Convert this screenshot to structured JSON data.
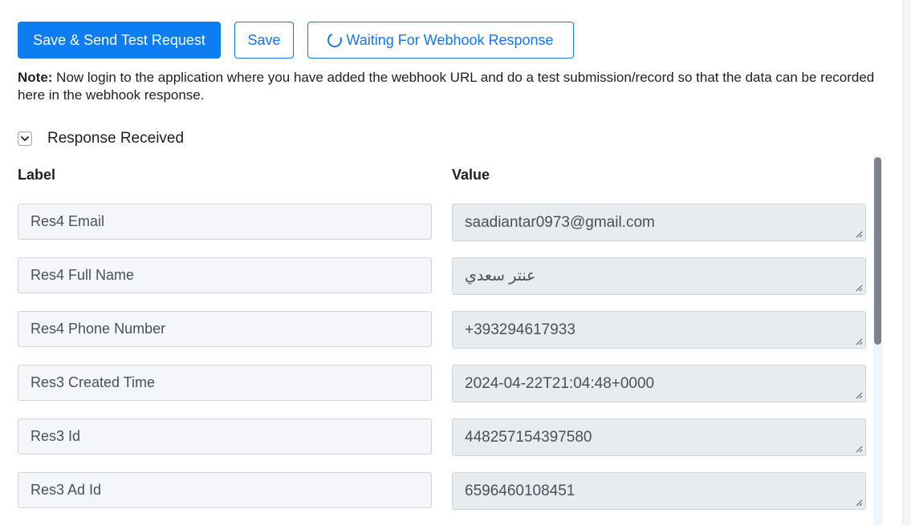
{
  "toolbar": {
    "save_send_label": "Save & Send Test Request",
    "save_label": "Save",
    "waiting_label": "Waiting For Webhook Response"
  },
  "note": {
    "prefix": "Note:",
    "text": " Now login to the application where you have added the webhook URL and do a test submission/record so that the data can be recorded here in the webhook response."
  },
  "response": {
    "toggle_label": "Response Received",
    "expanded": true,
    "label_header": "Label",
    "value_header": "Value",
    "rows": [
      {
        "label": "Res4 Email",
        "value": "saadiantar0973@gmail.com"
      },
      {
        "label": "Res4 Full Name",
        "value": "عنتر سعدي"
      },
      {
        "label": "Res4 Phone Number",
        "value": "+393294617933"
      },
      {
        "label": "Res3 Created Time",
        "value": "2024-04-22T21:04:48+0000"
      },
      {
        "label": "Res3 Id",
        "value": "448257154397580"
      },
      {
        "label": "Res3 Ad Id",
        "value": "6596460108451"
      }
    ]
  },
  "colors": {
    "primary": "#0f7df2",
    "outline_text": "#1776e8"
  }
}
